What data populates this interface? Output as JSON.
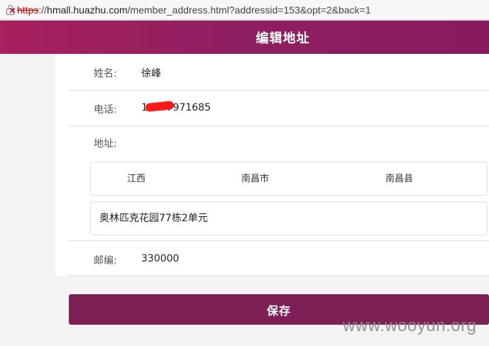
{
  "browser": {
    "url_scheme": "https",
    "url_rest_prefix": "://",
    "url_host": "hmall.huazhu.com",
    "url_path": "/member_address.html?addressid=153&opt=2&back=1"
  },
  "header": {
    "title": "编辑地址"
  },
  "form": {
    "name_label": "姓名:",
    "name_value": "徐峰",
    "phone_label": "电话:",
    "phone_value": "18907971685",
    "address_label": "地址:",
    "province": "江西",
    "city": "南昌市",
    "district": "南昌县",
    "detail_address": "奥林匹克花园77栋2单元",
    "postcode_label": "邮编:",
    "postcode_value": "330000"
  },
  "actions": {
    "save_label": "保存"
  },
  "watermark": "www.wooyun.org",
  "colors": {
    "header": "#8e1f60",
    "button": "#7d2056",
    "insecure_scheme": "#cc0000"
  }
}
